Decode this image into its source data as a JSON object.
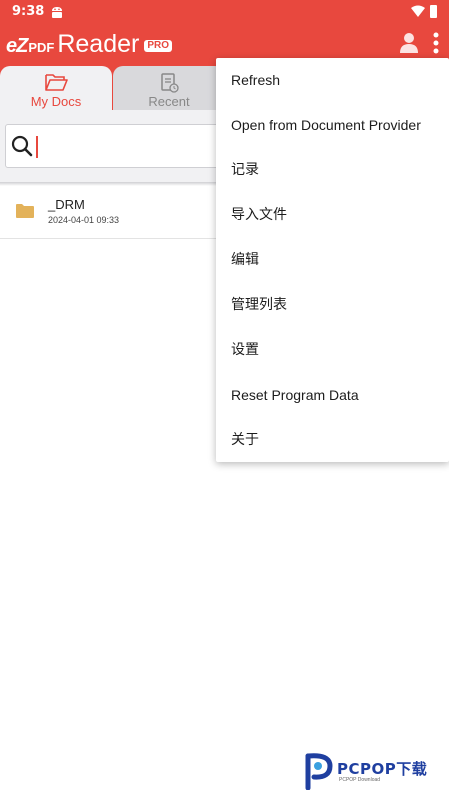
{
  "status_bar": {
    "time": "9:38",
    "icons": [
      "android-icon",
      "wifi-icon",
      "battery-icon"
    ]
  },
  "app_bar": {
    "logo": {
      "ez": "eZ",
      "pdf": "PDF",
      "reader": "Reader",
      "badge": "PRO"
    },
    "actions": [
      "user-icon",
      "more-vert-icon"
    ]
  },
  "tabs": [
    {
      "label": "My Docs",
      "icon": "folder-open-icon",
      "active": true
    },
    {
      "label": "Recent",
      "icon": "recent-doc-icon",
      "active": false
    }
  ],
  "search": {
    "value": "",
    "placeholder": ""
  },
  "files": [
    {
      "name": "_DRM",
      "date": "2024-04-01 09:33",
      "icon": "folder-icon"
    }
  ],
  "menu": {
    "items": [
      {
        "label": "Refresh"
      },
      {
        "label": "Open from Document Provider"
      },
      {
        "label": "记录"
      },
      {
        "label": "导入文件"
      },
      {
        "label": "编辑"
      },
      {
        "label": "管理列表"
      },
      {
        "label": "设置"
      },
      {
        "label": "Reset Program Data"
      },
      {
        "label": "关于"
      }
    ]
  },
  "watermark": {
    "brand": "PCPOP下载",
    "sub": "PCPOP Download"
  },
  "colors": {
    "accent": "#e8483e",
    "tab_bg": "#f1f1f3",
    "folder": "#e3b25a",
    "watermark": "#1f3fa0"
  }
}
